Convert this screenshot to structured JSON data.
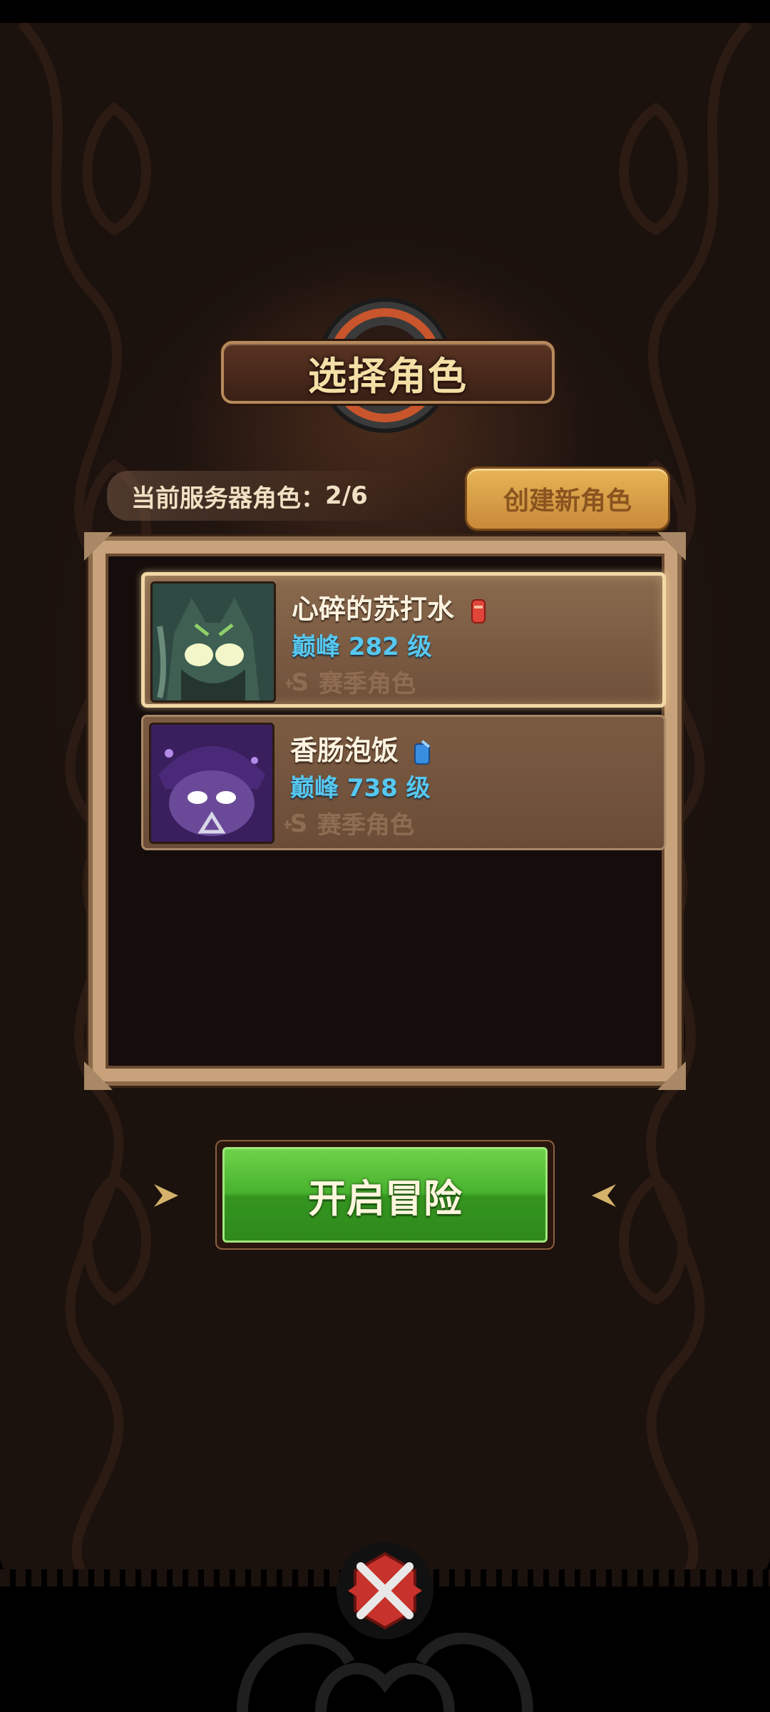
{
  "header": {
    "title": "选择角色"
  },
  "server": {
    "label": "当前服务器角色：",
    "count": "2/6",
    "create_label": "创建新角色"
  },
  "characters": [
    {
      "name": "心碎的苏打水",
      "level_prefix": "巅峰",
      "level": "282",
      "level_suffix": "级",
      "season_label": "赛季角色",
      "class_icon": "red-scroll-icon",
      "selected": true
    },
    {
      "name": "香肠泡饭",
      "level_prefix": "巅峰",
      "level": "738",
      "level_suffix": "级",
      "season_label": "赛季角色",
      "class_icon": "blue-gem-icon",
      "selected": false
    }
  ],
  "actions": {
    "start_label": "开启冒险"
  },
  "colors": {
    "level_text": "#57c8f0",
    "start_green": "#48b22e",
    "create_gold": "#e8b555"
  }
}
